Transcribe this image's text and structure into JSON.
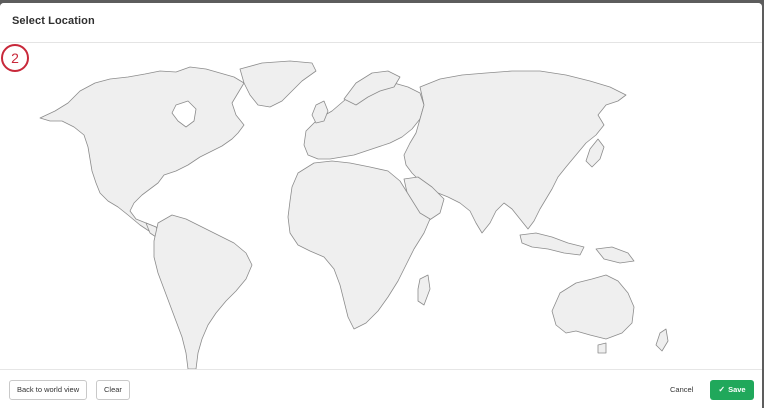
{
  "dialog": {
    "title": "Select Location"
  },
  "map": {
    "marker_number": "2",
    "marker_color": "#c8283a",
    "land_color": "#efefef",
    "border_color": "#8c8c8c"
  },
  "footer": {
    "back_label": "Back to world view",
    "clear_label": "Clear",
    "cancel_label": "Cancel",
    "save_label": "Save",
    "save_icon": "check-icon",
    "save_color": "#20a85b"
  }
}
